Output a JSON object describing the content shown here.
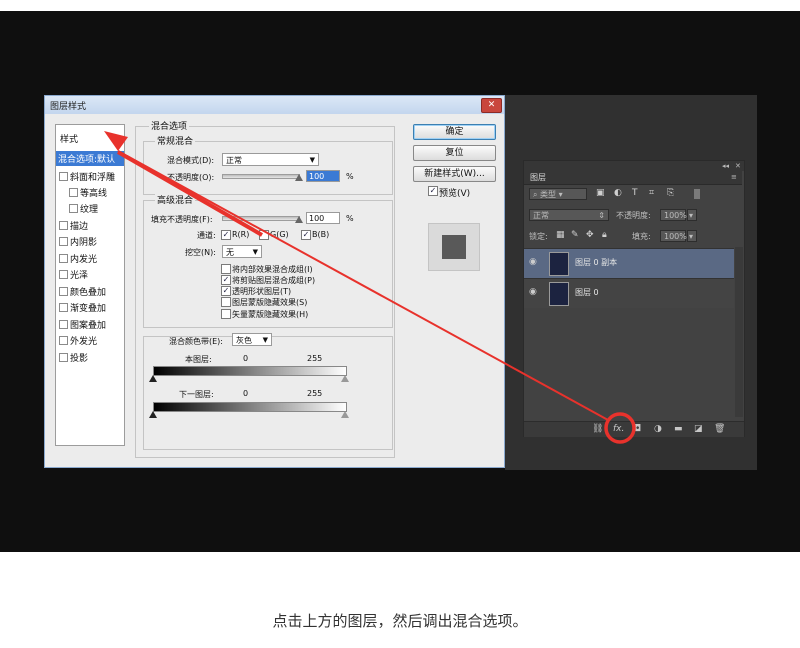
{
  "dialog": {
    "title": "图层样式",
    "close_label": "✕",
    "styles_list": {
      "header": "样式",
      "selected": "混合选项:默认",
      "items": [
        "斜面和浮雕",
        "等高线",
        "纹理",
        "描边",
        "内阴影",
        "内发光",
        "光泽",
        "颜色叠加",
        "渐变叠加",
        "图案叠加",
        "外发光",
        "投影"
      ]
    },
    "blend_options": {
      "section_title": "混合选项",
      "general": {
        "title": "常规混合",
        "mode_label": "混合模式(D):",
        "mode_value": "正常",
        "opacity_label": "不透明度(O):",
        "opacity_value": "100",
        "percent": "%"
      },
      "advanced": {
        "title": "高级混合",
        "fill_label": "填充不透明度(F):",
        "fill_value": "100",
        "percent": "%",
        "channels_label": "通道:",
        "channel_r": "R(R)",
        "channel_g": "G(G)",
        "channel_b": "B(B)",
        "channel_r_checked": true,
        "channel_g_checked": false,
        "channel_b_checked": true,
        "knockout_label": "挖空(N):",
        "knockout_value": "无",
        "checkboxes": [
          {
            "label": "将内部效果混合成组(I)",
            "checked": false
          },
          {
            "label": "将剪贴图层混合成组(P)",
            "checked": true
          },
          {
            "label": "透明形状图层(T)",
            "checked": true
          },
          {
            "label": "图层蒙版隐藏效果(S)",
            "checked": false
          },
          {
            "label": "矢量蒙版隐藏效果(H)",
            "checked": false
          }
        ]
      },
      "blend_if": {
        "label": "混合颜色带(E):",
        "value": "灰色",
        "this_layer_label": "本图层:",
        "this_low": "0",
        "this_high": "255",
        "underlying_label": "下一图层:",
        "under_low": "0",
        "under_high": "255"
      }
    },
    "buttons": {
      "ok": "确定",
      "reset": "复位",
      "new_style": "新建样式(W)...",
      "preview_label": "预览(V)",
      "preview_checked": true
    }
  },
  "layers_panel": {
    "tab": "图层",
    "filter_kind": "类型",
    "blend_mode": "正常",
    "opacity_label": "不透明度:",
    "opacity_value": "100%",
    "lock_label": "锁定:",
    "fill_label": "填充:",
    "fill_value": "100%",
    "layers": [
      {
        "name": "图层 0 副本",
        "selected": true
      },
      {
        "name": "图层 0",
        "selected": false
      }
    ],
    "fx_label": "fx."
  },
  "colors": {
    "accent": "#3b7ad4",
    "annotation_red": "#e8322c"
  },
  "caption": "点击上方的图层，然后调出混合选项。"
}
